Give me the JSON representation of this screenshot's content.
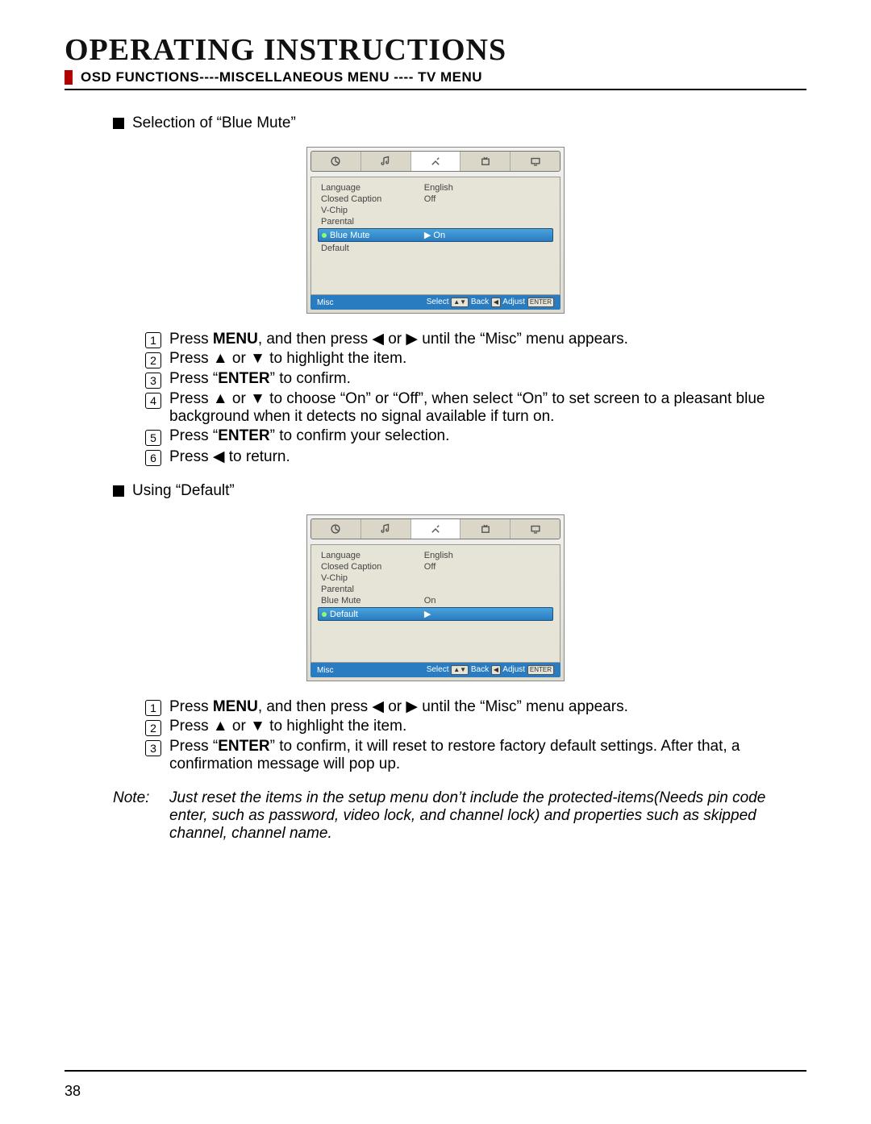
{
  "title": "OPERATING INSTRUCTIONS",
  "subtitle": "OSD FUNCTIONS----MISCELLANEOUS MENU ---- TV MENU",
  "page_number": "38",
  "section1": {
    "heading": "Selection of “Blue Mute”",
    "osd": {
      "rows": [
        {
          "label": "Language",
          "value": "English"
        },
        {
          "label": "Closed Caption",
          "value": "Off"
        },
        {
          "label": "V-Chip",
          "value": ""
        },
        {
          "label": "Parental",
          "value": ""
        },
        {
          "label": "Blue Mute",
          "value": "▶ On",
          "selected": true
        },
        {
          "label": "Default",
          "value": ""
        }
      ],
      "foot_left": "Misc",
      "foot_right_select": "Select",
      "foot_right_back": "Back",
      "foot_right_adjust": "Adjust",
      "foot_right_enter": "ENTER"
    },
    "steps": [
      "Press <b>MENU</b>, and then press ◀ or ▶ until the “Misc” menu appears.",
      "Press ▲ or ▼ to highlight the item.",
      "Press “<b>ENTER</b>” to confirm.",
      "Press ▲ or ▼ to choose “On” or “Off”, when select “On” to set screen to a pleasant blue background when it detects no signal available if turn on.",
      "Press “<b>ENTER</b>” to confirm your selection.",
      "Press ◀ to return."
    ]
  },
  "section2": {
    "heading": "Using “Default”",
    "osd": {
      "rows": [
        {
          "label": "Language",
          "value": "English"
        },
        {
          "label": "Closed Caption",
          "value": "Off"
        },
        {
          "label": "V-Chip",
          "value": ""
        },
        {
          "label": "Parental",
          "value": ""
        },
        {
          "label": "Blue Mute",
          "value": "On"
        },
        {
          "label": "Default",
          "value": "▶",
          "selected": true
        }
      ],
      "foot_left": "Misc",
      "foot_right_select": "Select",
      "foot_right_back": "Back",
      "foot_right_adjust": "Adjust",
      "foot_right_enter": "ENTER"
    },
    "steps": [
      "Press <b>MENU</b>, and then press ◀ or ▶ until the “Misc” menu appears.",
      "Press ▲ or ▼ to highlight the item.",
      "Press “<b>ENTER</b>” to confirm, it will reset to restore factory default settings. After that, a confirmation message will pop up."
    ]
  },
  "note": {
    "label": "Note:",
    "text": "Just reset the items in the setup menu don’t include the protected-items(Needs pin code enter, such as password, video lock, and channel lock) and properties such as skipped channel, channel name."
  }
}
